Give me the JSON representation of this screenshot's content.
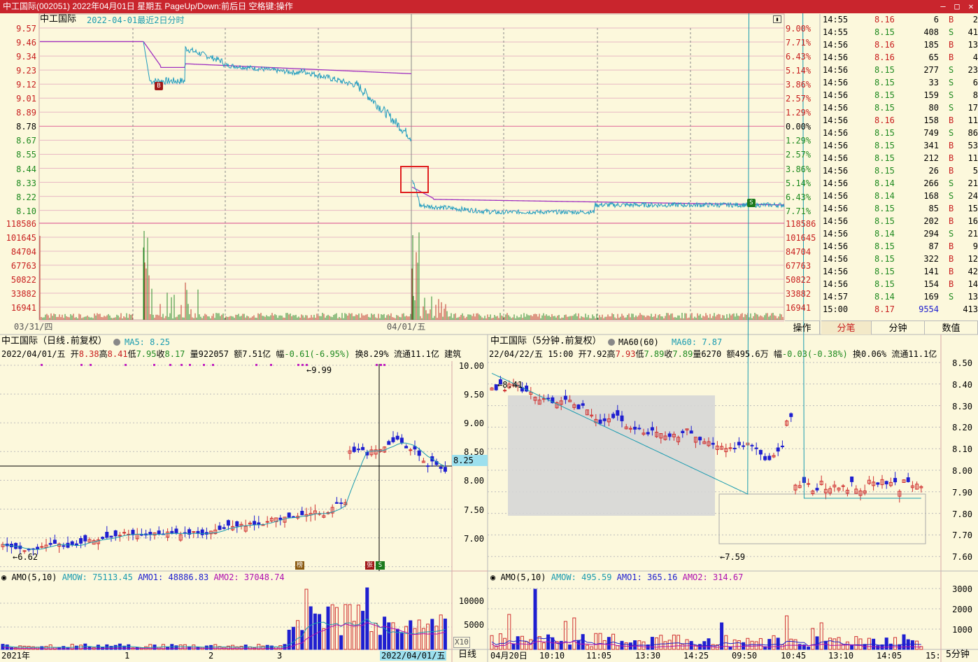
{
  "window": {
    "title": "中工国际(002051) 2022年04月01日 星期五 PageUp/Down:前后日 空格键:操作",
    "minimize": "—",
    "maximize": "□",
    "close": "✕"
  },
  "intraday": {
    "name": "中工国际",
    "subtitle": "2022-04-01最近2日分时",
    "price_labels": [
      "9.57",
      "9.46",
      "9.34",
      "9.23",
      "9.12",
      "9.01",
      "8.89",
      "8.78",
      "8.67",
      "8.55",
      "8.44",
      "8.33",
      "8.22",
      "8.10"
    ],
    "pct_labels": [
      "9.00%",
      "7.71%",
      "6.43%",
      "5.14%",
      "3.86%",
      "2.57%",
      "1.29%",
      "0.00%",
      "1.29%",
      "2.57%",
      "3.86%",
      "5.14%",
      "6.43%",
      "7.71%"
    ],
    "vol_labels": [
      "118586",
      "101645",
      "84704",
      "67763",
      "50822",
      "33882",
      "16941"
    ],
    "date_labels": [
      "03/31/四",
      "04/01/五"
    ],
    "marker_b": "B",
    "marker_s": "S"
  },
  "tick_tabs": [
    "操作",
    "分笔",
    "分钟",
    "数值"
  ],
  "ticks": [
    [
      "14:55",
      "8.16",
      "6",
      "B",
      "2"
    ],
    [
      "14:55",
      "8.15",
      "408",
      "S",
      "41"
    ],
    [
      "14:56",
      "8.16",
      "185",
      "B",
      "13"
    ],
    [
      "14:56",
      "8.16",
      "65",
      "B",
      "4"
    ],
    [
      "14:56",
      "8.15",
      "277",
      "S",
      "23"
    ],
    [
      "14:56",
      "8.15",
      "33",
      "S",
      "6"
    ],
    [
      "14:56",
      "8.15",
      "159",
      "S",
      "8"
    ],
    [
      "14:56",
      "8.15",
      "80",
      "S",
      "17"
    ],
    [
      "14:56",
      "8.16",
      "158",
      "B",
      "11"
    ],
    [
      "14:56",
      "8.15",
      "749",
      "S",
      "86"
    ],
    [
      "14:56",
      "8.15",
      "341",
      "B",
      "53"
    ],
    [
      "14:56",
      "8.15",
      "212",
      "B",
      "11"
    ],
    [
      "14:56",
      "8.15",
      "26",
      "B",
      "5"
    ],
    [
      "14:56",
      "8.14",
      "266",
      "S",
      "21"
    ],
    [
      "14:56",
      "8.14",
      "168",
      "S",
      "24"
    ],
    [
      "14:56",
      "8.15",
      "85",
      "B",
      "15"
    ],
    [
      "14:56",
      "8.15",
      "202",
      "B",
      "16"
    ],
    [
      "14:56",
      "8.14",
      "294",
      "S",
      "21"
    ],
    [
      "14:56",
      "8.15",
      "87",
      "B",
      "9"
    ],
    [
      "14:56",
      "8.15",
      "322",
      "B",
      "12"
    ],
    [
      "14:56",
      "8.15",
      "141",
      "B",
      "42"
    ],
    [
      "14:56",
      "8.15",
      "154",
      "B",
      "14"
    ],
    [
      "14:57",
      "8.14",
      "169",
      "S",
      "13"
    ],
    [
      "15:00",
      "8.17",
      "9554",
      "",
      "413"
    ]
  ],
  "daily": {
    "header": "中工国际（日线.前复权）",
    "ma_label": "MA5: 8.25",
    "info": {
      "date": "2022/04/01/五",
      "open_l": "开",
      "open": "8.38",
      "high_l": "高",
      "high": "8.41",
      "low_l": "低",
      "low": "7.95",
      "close_l": "收",
      "close": "8.17",
      "vol_l": "量",
      "vol": "922057",
      "amt_l": "额",
      "amt": "7.51亿",
      "chg_l": "幅",
      "chg": "-0.61(-6.95%)",
      "turn_l": "换",
      "turn": "8.29%",
      "float_l": "流通",
      "float": "11.1亿",
      "extra": "建筑"
    },
    "price_axis": [
      "10.00",
      "9.50",
      "9.00",
      "8.50",
      "8.00",
      "7.50",
      "7.00"
    ],
    "cursor_value": "8.25",
    "max_label": "9.99",
    "min_label": "6.62",
    "amo_header": "AMO(5,10)",
    "amow": "AMOW: 75113.45",
    "amo1": "AMO1: 48886.83",
    "amo2": "AMO2: 37048.74",
    "amo_axis": [
      "10000",
      "5000"
    ],
    "amo_unit": "X10",
    "x_labels": [
      "2021年",
      "1",
      "2",
      "3",
      "2022/04/01/五"
    ],
    "period_label": "日线",
    "badges": [
      "榜",
      "张",
      "S"
    ]
  },
  "m5": {
    "header": "中工国际（5分钟.前复权）",
    "ma_label": "MA60(60)",
    "ma_value": "MA60: 7.87",
    "info": {
      "date": "22/04/22/五",
      "time": "15:00",
      "open_l": "开",
      "open": "7.92",
      "high_l": "高",
      "high": "7.93",
      "low_l": "低",
      "low": "7.89",
      "close_l": "收",
      "close": "7.89",
      "vol_l": "量",
      "vol": "6270",
      "amt_l": "额",
      "amt": "495.6万",
      "chg_l": "幅",
      "chg": "-0.03(-0.38%)",
      "turn_l": "换",
      "turn": "0.06%",
      "float_l": "流通",
      "float": "11.1亿"
    },
    "price_axis": [
      "8.50",
      "8.40",
      "8.30",
      "8.20",
      "8.10",
      "8.00",
      "7.90",
      "7.80",
      "7.70",
      "7.60"
    ],
    "max_label": "8.41",
    "min_label": "7.59",
    "amo_header": "AMO(5,10)",
    "amow": "AMOW: 495.59",
    "amo1": "AMO1: 365.16",
    "amo2": "AMO2: 314.67",
    "amo_axis": [
      "3000",
      "2000",
      "1000"
    ],
    "x_labels": [
      "04月20日",
      "10:10",
      "11:05",
      "13:30",
      "14:25",
      "09:50",
      "10:45",
      "13:10",
      "14:05",
      "15:"
    ],
    "period_label": "5分钟"
  },
  "chart_data": [
    {
      "type": "line",
      "title": "中工国际 2022-04-01最近2日分时",
      "x": [
        "03/31/四",
        "04/01/五"
      ],
      "series": [],
      "y_range": [
        8.1,
        9.57
      ],
      "prev_close_day1": 9.46,
      "prev_close_day2": 8.78
    },
    {
      "type": "bar",
      "title": "中工国际（日线.前复权）",
      "y_range": [
        6.62,
        9.99
      ],
      "last": {
        "open": 8.38,
        "high": 8.41,
        "low": 7.95,
        "close": 8.17
      },
      "ma5": 8.25
    },
    {
      "type": "bar",
      "title": "中工国际（5分钟.前复权）",
      "y_range": [
        7.59,
        8.41
      ],
      "last": {
        "open": 7.92,
        "high": 7.93,
        "low": 7.89,
        "close": 7.89
      },
      "ma60": 7.87
    }
  ]
}
